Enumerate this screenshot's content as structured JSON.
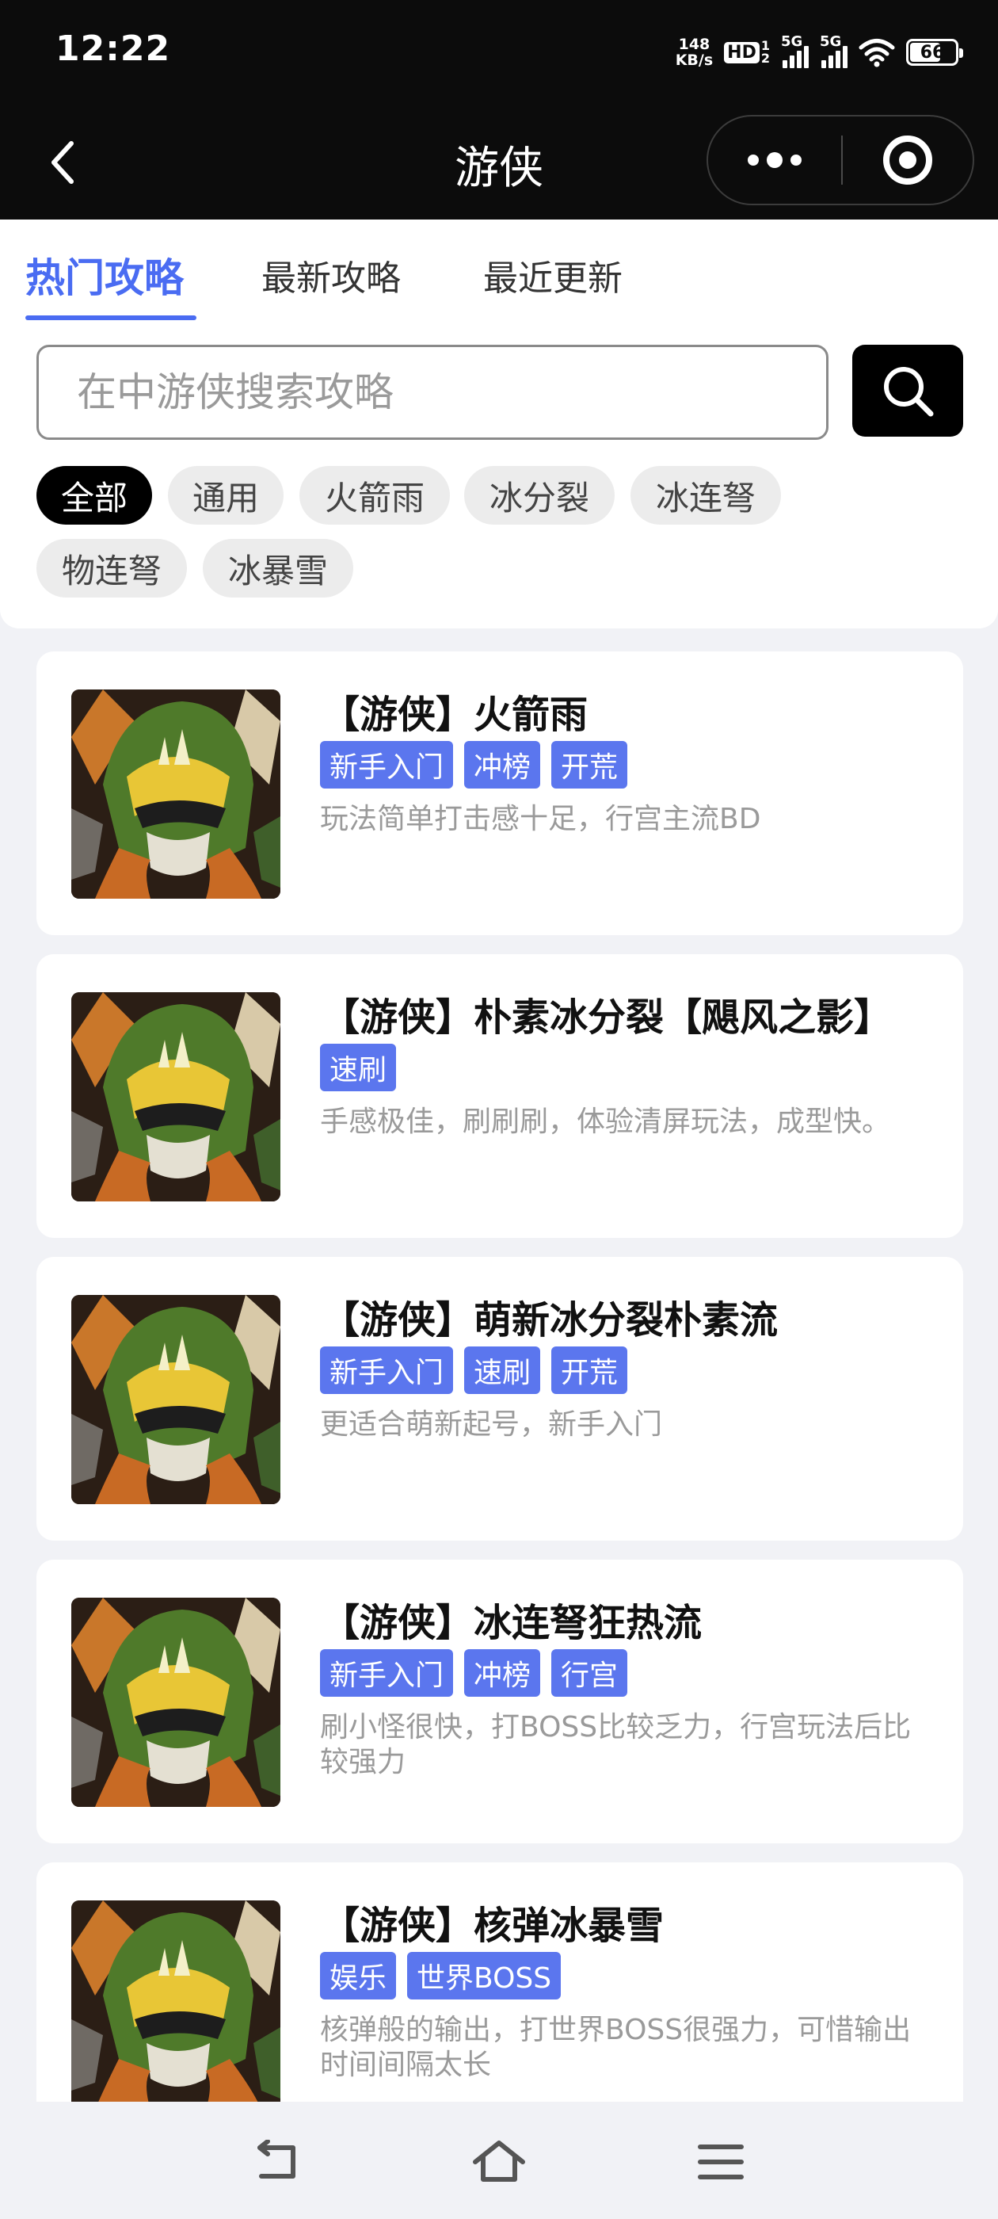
{
  "status_bar": {
    "time": "12:22",
    "net_speed_value": "148",
    "net_speed_unit": "KB/s",
    "hd_label": "HD",
    "hd_sub": "1",
    "hd_sub2": "2",
    "signal1_label": "5G",
    "signal2_label": "5G",
    "battery_level": "66"
  },
  "nav": {
    "title": "游侠"
  },
  "tabs": [
    {
      "label": "热门攻略",
      "active": true
    },
    {
      "label": "最新攻略",
      "active": false
    },
    {
      "label": "最近更新",
      "active": false
    }
  ],
  "search": {
    "placeholder": "在中游侠搜索攻略",
    "value": ""
  },
  "filters": [
    {
      "label": "全部",
      "active": true
    },
    {
      "label": "通用",
      "active": false
    },
    {
      "label": "火箭雨",
      "active": false
    },
    {
      "label": "冰分裂",
      "active": false
    },
    {
      "label": "冰连弩",
      "active": false
    },
    {
      "label": "物连弩",
      "active": false
    },
    {
      "label": "冰暴雪",
      "active": false
    }
  ],
  "guides": [
    {
      "title": "【游侠】火箭雨",
      "tags": [
        "新手入门",
        "冲榜",
        "开荒"
      ],
      "desc": "玩法简单打击感十足，行宫主流BD"
    },
    {
      "title": "【游侠】朴素冰分裂【飓风之影】",
      "tags": [
        "速刷"
      ],
      "desc": "手感极佳，刷刷刷，体验清屏玩法，成型快。"
    },
    {
      "title": "【游侠】萌新冰分裂朴素流",
      "tags": [
        "新手入门",
        "速刷",
        "开荒"
      ],
      "desc": "更适合萌新起号，新手入门"
    },
    {
      "title": "【游侠】冰连弩狂热流",
      "tags": [
        "新手入门",
        "冲榜",
        "行宫"
      ],
      "desc": "刷小怪很快，打BOSS比较乏力，行宫玩法后比较强力"
    },
    {
      "title": "【游侠】核弹冰暴雪",
      "tags": [
        "娱乐",
        "世界BOSS"
      ],
      "desc": "核弹般的输出，打世界BOSS很强力，可惜输出时间间隔太长"
    }
  ],
  "colors": {
    "accent": "#4a6cf2",
    "tag_bg": "#5b76ee",
    "header_bg": "#0c0c0c",
    "page_bg": "#f1f2f6"
  },
  "icons": {
    "back": "chevron-left-icon",
    "more": "more-dots-icon",
    "close": "target-close-icon",
    "search": "search-icon",
    "sys_back": "back-arrow-icon",
    "sys_home": "home-icon",
    "sys_menu": "menu-icon"
  }
}
